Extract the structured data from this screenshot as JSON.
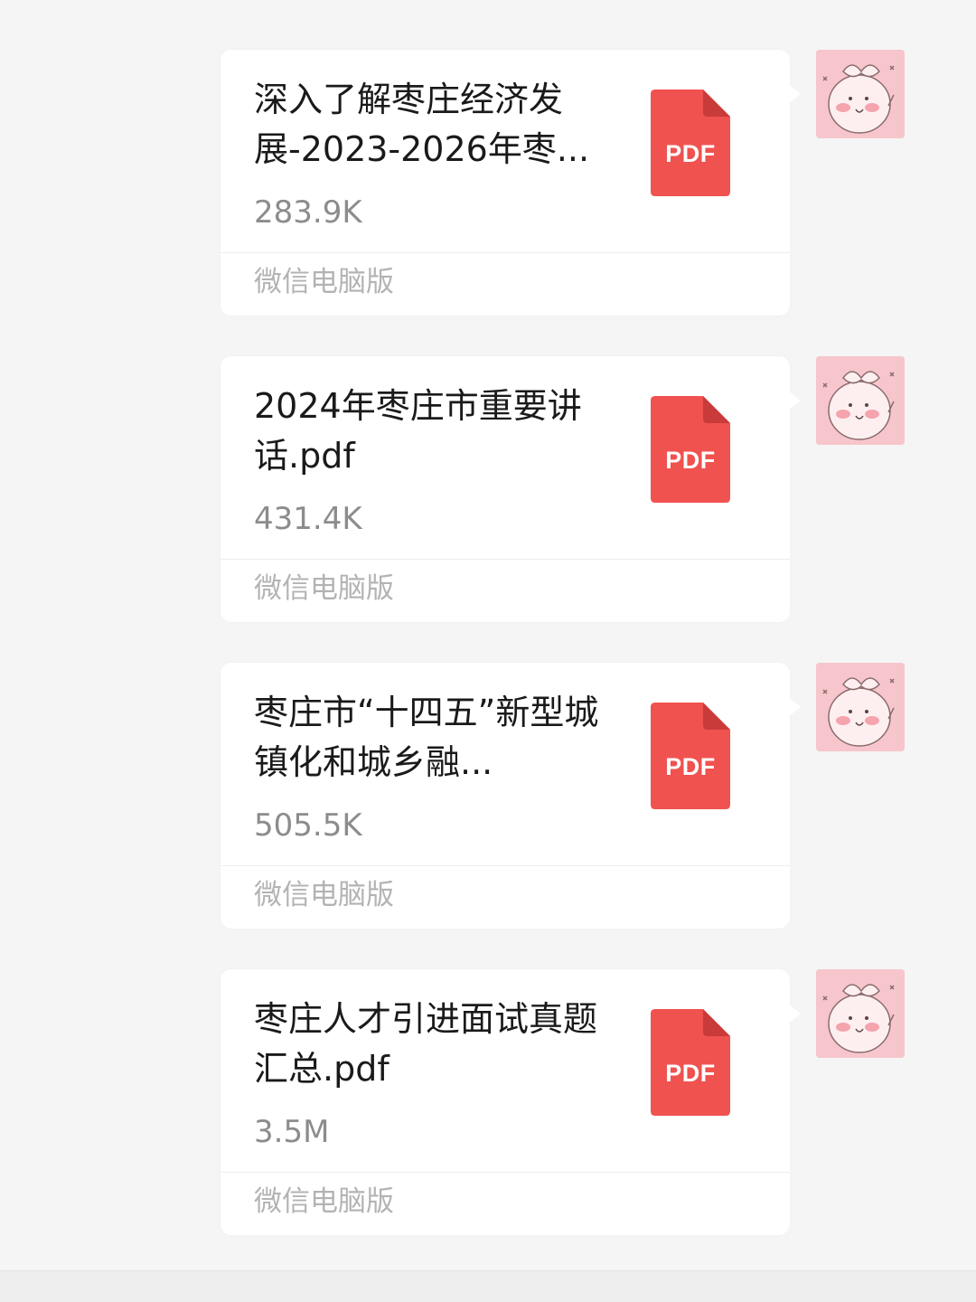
{
  "colors": {
    "background": "#f5f5f5",
    "bubble": "#ffffff",
    "pdf_red": "#f0524f",
    "pdf_fold": "#c93b3a",
    "avatar_bg": "#f6c6cc"
  },
  "messages": [
    {
      "file_name": "深入了解枣庄经济发展-2023-2026年枣...",
      "file_size": "283.9K",
      "file_type_label": "PDF",
      "source": "微信电脑版",
      "avatar_icon": "bear-sticker-icon"
    },
    {
      "file_name": "2024年枣庄市重要讲话.pdf",
      "file_size": "431.4K",
      "file_type_label": "PDF",
      "source": "微信电脑版",
      "avatar_icon": "bear-sticker-icon"
    },
    {
      "file_name": "枣庄市“十四五”新型城镇化和城乡融...",
      "file_size": "505.5K",
      "file_type_label": "PDF",
      "source": "微信电脑版",
      "avatar_icon": "bear-sticker-icon"
    },
    {
      "file_name": "枣庄人才引进面试真题汇总.pdf",
      "file_size": "3.5M",
      "file_type_label": "PDF",
      "source": "微信电脑版",
      "avatar_icon": "bear-sticker-icon"
    }
  ]
}
